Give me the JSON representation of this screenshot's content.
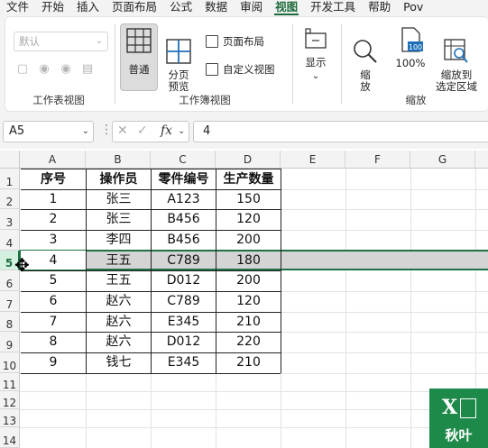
{
  "menu": [
    "文件",
    "开始",
    "插入",
    "页面布局",
    "公式",
    "数据",
    "审阅",
    "视图",
    "开发工具",
    "帮助",
    "Pov"
  ],
  "active_menu": "视图",
  "ribbon": {
    "sheet_view": {
      "dropdown_value": "默认",
      "label": "工作表视图"
    },
    "workbook_view": {
      "normal": "普通",
      "page_break": "分页\n预览",
      "page_layout": "页面布局",
      "custom_views": "自定义视图",
      "label": "工作簿视图"
    },
    "show": {
      "label": "显示"
    },
    "zoom": {
      "zoom": "缩\n放",
      "hundred": "100%",
      "hundred_icon_text": "100",
      "zoom_selection": "缩放到\n选定区域",
      "label": "缩放"
    }
  },
  "formula_bar": {
    "name_box": "A5",
    "fx": "fx",
    "value": "4"
  },
  "columns": [
    "A",
    "B",
    "C",
    "D",
    "E",
    "F",
    "G"
  ],
  "rows": [
    "1",
    "2",
    "3",
    "4",
    "5",
    "6",
    "7",
    "8",
    "9",
    "10",
    "11",
    "12",
    "13",
    "14"
  ],
  "table": {
    "headers": [
      "序号",
      "操作员",
      "零件编号",
      "生产数量"
    ],
    "data": [
      [
        "1",
        "张三",
        "A123",
        "150"
      ],
      [
        "2",
        "张三",
        "B456",
        "120"
      ],
      [
        "3",
        "李四",
        "B456",
        "200"
      ],
      [
        "4",
        "王五",
        "C789",
        "180"
      ],
      [
        "5",
        "王五",
        "D012",
        "200"
      ],
      [
        "6",
        "赵六",
        "C789",
        "120"
      ],
      [
        "7",
        "赵六",
        "E345",
        "210"
      ],
      [
        "8",
        "赵六",
        "D012",
        "220"
      ],
      [
        "9",
        "钱七",
        "E345",
        "210"
      ]
    ]
  },
  "selected_row": "5",
  "logo_text": "秋叶",
  "colors": {
    "accent": "#1e7145",
    "selected_fill": "#d4d4d4",
    "ribbon_bg": "#f3f3f3"
  }
}
